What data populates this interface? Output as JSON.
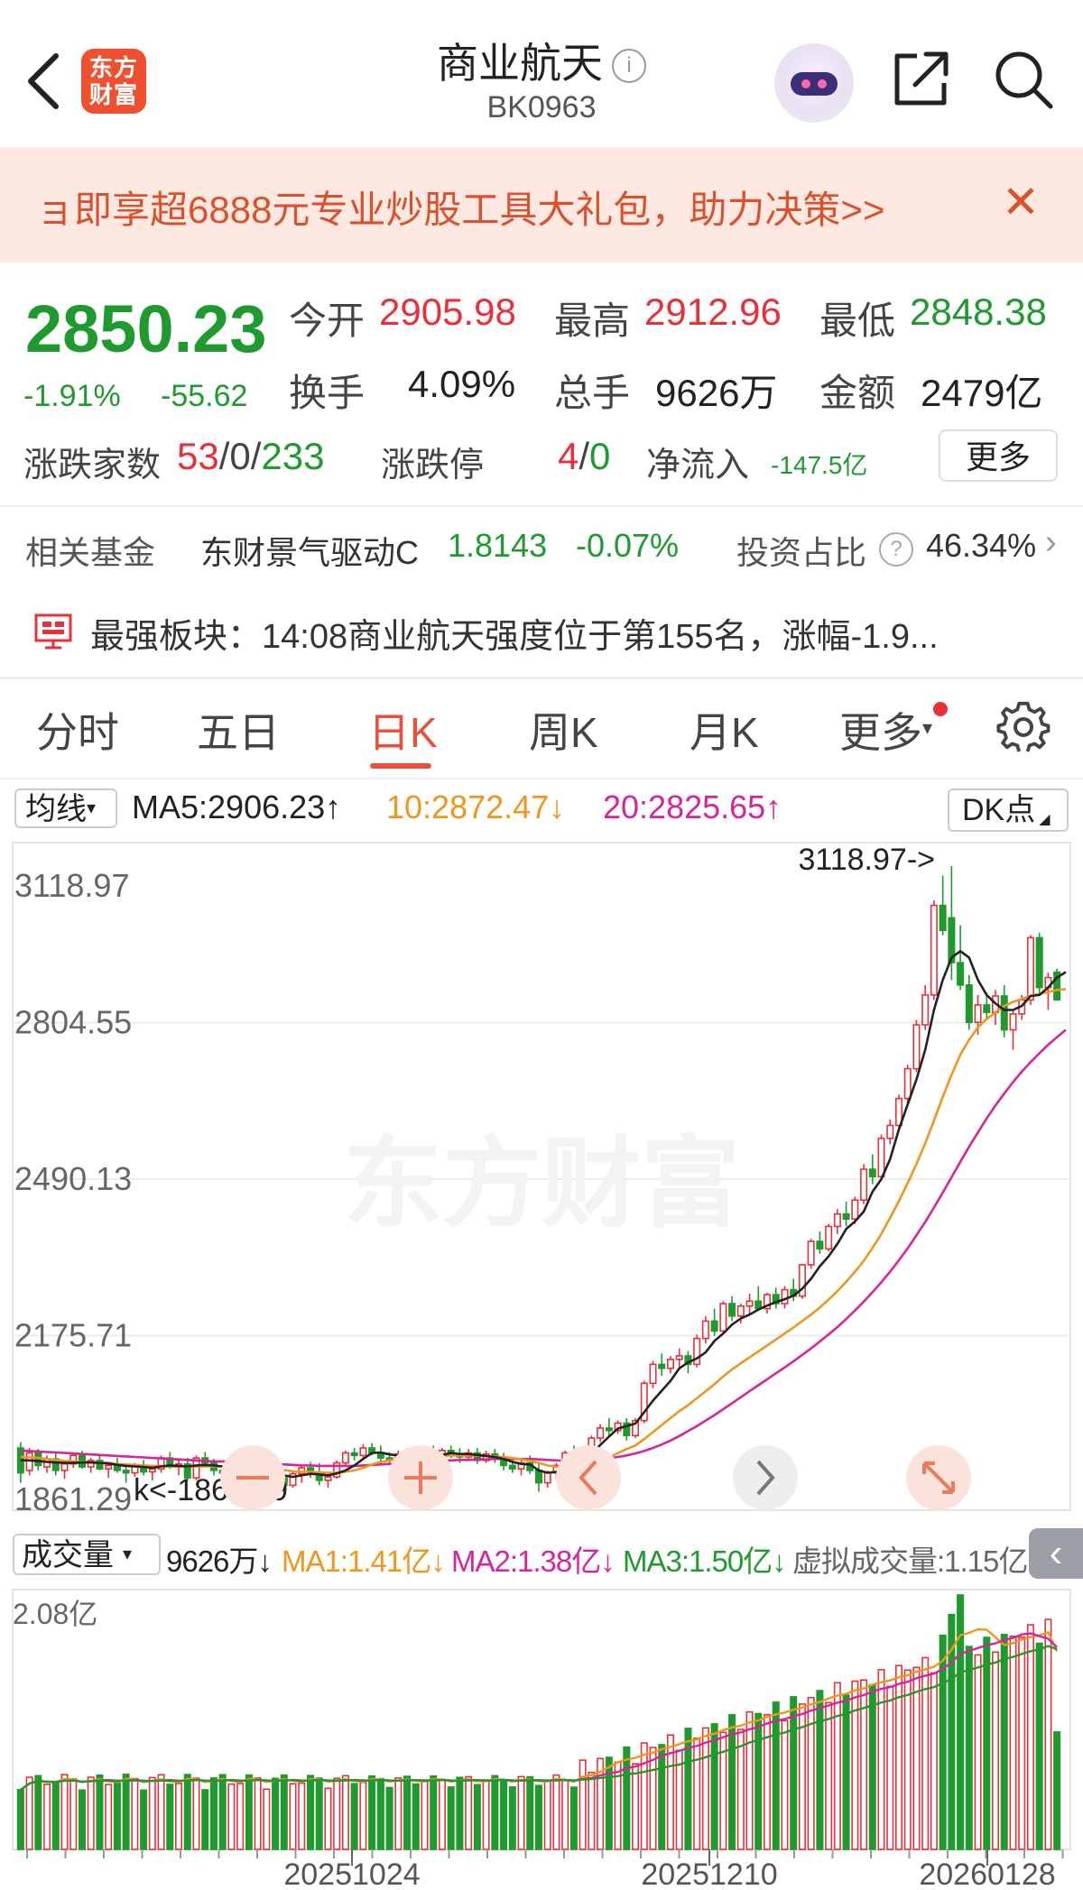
{
  "header": {
    "back_icon": "chevron-left-icon",
    "logo_line1": "东方",
    "logo_line2": "财富",
    "title": "商业航天",
    "info_icon": "i",
    "code": "BK0963",
    "share_icon": "share-icon",
    "search_icon": "search-icon"
  },
  "banner": {
    "text": "ョ即享超6888元专业炒股工具大礼包，助力决策>>",
    "close": "✕"
  },
  "quote": {
    "price": "2850.23",
    "change_pct": "-1.91%",
    "change": "-55.62",
    "open_label": "今开",
    "open": "2905.98",
    "high_label": "最高",
    "high": "2912.96",
    "low_label": "最低",
    "low": "2848.38",
    "turnover_label": "换手",
    "turnover": "4.09%",
    "volume_label": "总手",
    "volume": "9626万",
    "amount_label": "金额",
    "amount": "2479亿",
    "updown_label": "涨跌家数",
    "up": "53",
    "sep1": "/",
    "flat": "0",
    "sep2": "/",
    "down": "233",
    "limit_label": "涨跌停",
    "limit_up": "4",
    "sep3": "/",
    "limit_down": "0",
    "netflow_label": "净流入",
    "netflow": "-147.5亿",
    "more_button": "更多"
  },
  "fund": {
    "label": "相关基金",
    "name": "东财景气驱动C",
    "value": "1.8143",
    "pct": "-0.07%",
    "ratio_label": "投资占比",
    "ratio": "46.34%",
    "arrow": "›"
  },
  "strongest": {
    "text": "最强板块：14:08商业航天强度位于第155名，涨幅-1.9..."
  },
  "tabs": [
    "分时",
    "五日",
    "日K",
    "周K",
    "月K",
    "更多",
    "⚙"
  ],
  "indicators": {
    "ma_select": "均线",
    "ma5": "MA5:2906.23↑",
    "ma10": "10:2872.47↓",
    "ma20": "20:2825.65↑",
    "dk_button": "DK点",
    "colors": {
      "ma5": "#222222",
      "ma10": "#f0961e",
      "ma20": "#d6259c",
      "up": "#e9303a",
      "down": "#1f9a2e"
    }
  },
  "volume_row": {
    "select": "成交量",
    "current": "9626万↓",
    "ma1": "MA1:1.41亿↓",
    "ma2": "MA2:1.38亿↓",
    "ma3": "MA3:1.50亿↓",
    "virtual": "虚拟成交量:1.15亿",
    "collapse_icon": "‹"
  },
  "chart_data": [
    {
      "type": "candlestick",
      "title": "",
      "y_ticks": [
        "3118.97",
        "2804.55",
        "2490.13",
        "2175.71",
        "1861.29"
      ],
      "ylim": [
        1861.29,
        3118.97
      ],
      "max_annotation": "3118.97->",
      "min_annotation": "1861.29",
      "watermark": "东方财富",
      "candles": [
        [
          1950,
          1962,
          1880,
          1900
        ],
        [
          1905,
          1950,
          1895,
          1940
        ],
        [
          1940,
          1948,
          1905,
          1915
        ],
        [
          1912,
          1935,
          1900,
          1928
        ],
        [
          1928,
          1940,
          1895,
          1905
        ],
        [
          1905,
          1925,
          1888,
          1918
        ],
        [
          1918,
          1940,
          1910,
          1935
        ],
        [
          1935,
          1945,
          1908,
          1912
        ],
        [
          1912,
          1930,
          1900,
          1925
        ],
        [
          1925,
          1938,
          1905,
          1908
        ],
        [
          1908,
          1922,
          1890,
          1915
        ],
        [
          1915,
          1930,
          1900,
          1905
        ],
        [
          1905,
          1912,
          1880,
          1900
        ],
        [
          1900,
          1920,
          1892,
          1915
        ],
        [
          1915,
          1926,
          1895,
          1902
        ],
        [
          1902,
          1915,
          1885,
          1908
        ],
        [
          1908,
          1935,
          1900,
          1930
        ],
        [
          1930,
          1942,
          1908,
          1912
        ],
        [
          1912,
          1925,
          1895,
          1918
        ],
        [
          1918,
          1930,
          1885,
          1890
        ],
        [
          1890,
          1935,
          1885,
          1930
        ],
        [
          1930,
          1942,
          1915,
          1920
        ],
        [
          1920,
          1928,
          1895,
          1905
        ],
        [
          1905,
          1915,
          1878,
          1900
        ],
        [
          1900,
          1925,
          1895,
          1912
        ],
        [
          1912,
          1926,
          1900,
          1922
        ],
        [
          1922,
          1928,
          1890,
          1896
        ],
        [
          1896,
          1910,
          1880,
          1905
        ],
        [
          1905,
          1925,
          1895,
          1915
        ],
        [
          1915,
          1925,
          1882,
          1890
        ],
        [
          1890,
          1905,
          1850,
          1875
        ],
        [
          1875,
          1902,
          1870,
          1898
        ],
        [
          1898,
          1915,
          1880,
          1910
        ],
        [
          1910,
          1922,
          1890,
          1900
        ],
        [
          1900,
          1920,
          1875,
          1885
        ],
        [
          1885,
          1898,
          1870,
          1892
        ],
        [
          1892,
          1925,
          1888,
          1920
        ],
        [
          1920,
          1945,
          1915,
          1940
        ],
        [
          1940,
          1950,
          1925,
          1935
        ],
        [
          1935,
          1958,
          1930,
          1950
        ],
        [
          1950,
          1960,
          1935,
          1940
        ],
        [
          1940,
          1955,
          1920,
          1930
        ],
        [
          1930,
          1942,
          1915,
          1925
        ],
        [
          1925,
          1945,
          1918,
          1938
        ],
        [
          1938,
          1950,
          1920,
          1928
        ],
        [
          1928,
          1945,
          1910,
          1920
        ],
        [
          1920,
          1945,
          1918,
          1940
        ],
        [
          1940,
          1955,
          1930,
          1935
        ],
        [
          1935,
          1950,
          1925,
          1945
        ],
        [
          1945,
          1955,
          1930,
          1938
        ],
        [
          1938,
          1950,
          1920,
          1932
        ],
        [
          1932,
          1948,
          1925,
          1940
        ],
        [
          1940,
          1950,
          1918,
          1925
        ],
        [
          1925,
          1945,
          1920,
          1938
        ],
        [
          1938,
          1948,
          1920,
          1930
        ],
        [
          1930,
          1940,
          1905,
          1915
        ],
        [
          1915,
          1930,
          1900,
          1908
        ],
        [
          1908,
          1925,
          1895,
          1920
        ],
        [
          1920,
          1935,
          1898,
          1905
        ],
        [
          1905,
          1920,
          1862,
          1880
        ],
        [
          1880,
          1905,
          1870,
          1900
        ],
        [
          1900,
          1920,
          1888,
          1915
        ],
        [
          1915,
          1945,
          1910,
          1940
        ],
        [
          1940,
          1955,
          1920,
          1928
        ],
        [
          1928,
          1948,
          1920,
          1942
        ],
        [
          1942,
          1975,
          1938,
          1970
        ],
        [
          1970,
          1998,
          1962,
          1990
        ],
        [
          1990,
          2010,
          1975,
          1985
        ],
        [
          1985,
          2005,
          1978,
          2000
        ],
        [
          2000,
          2010,
          1965,
          1975
        ],
        [
          1975,
          2010,
          1970,
          2005
        ],
        [
          2005,
          2085,
          2000,
          2080
        ],
        [
          2080,
          2125,
          2070,
          2118
        ],
        [
          2118,
          2140,
          2095,
          2110
        ],
        [
          2110,
          2135,
          2100,
          2128
        ],
        [
          2128,
          2150,
          2110,
          2135
        ],
        [
          2135,
          2145,
          2100,
          2118
        ],
        [
          2118,
          2178,
          2112,
          2170
        ],
        [
          2170,
          2215,
          2160,
          2205
        ],
        [
          2205,
          2230,
          2175,
          2185
        ],
        [
          2185,
          2245,
          2180,
          2240
        ],
        [
          2240,
          2255,
          2205,
          2215
        ],
        [
          2215,
          2240,
          2200,
          2235
        ],
        [
          2235,
          2260,
          2218,
          2245
        ],
        [
          2245,
          2275,
          2225,
          2230
        ],
        [
          2230,
          2262,
          2220,
          2258
        ],
        [
          2258,
          2272,
          2230,
          2240
        ],
        [
          2240,
          2275,
          2230,
          2268
        ],
        [
          2268,
          2290,
          2245,
          2255
        ],
        [
          2255,
          2320,
          2250,
          2318
        ],
        [
          2318,
          2370,
          2310,
          2365
        ],
        [
          2365,
          2385,
          2340,
          2350
        ],
        [
          2350,
          2400,
          2345,
          2395
        ],
        [
          2395,
          2430,
          2380,
          2420
        ],
        [
          2420,
          2445,
          2395,
          2410
        ],
        [
          2410,
          2455,
          2400,
          2448
        ],
        [
          2448,
          2520,
          2440,
          2510
        ],
        [
          2510,
          2540,
          2480,
          2495
        ],
        [
          2495,
          2580,
          2490,
          2572
        ],
        [
          2572,
          2610,
          2560,
          2598
        ],
        [
          2598,
          2660,
          2590,
          2652
        ],
        [
          2652,
          2720,
          2640,
          2712
        ],
        [
          2712,
          2810,
          2705,
          2800
        ],
        [
          2800,
          2880,
          2790,
          2860
        ],
        [
          2860,
          3050,
          2850,
          3040
        ],
        [
          3040,
          3100,
          2980,
          2990
        ],
        [
          3015,
          3118.97,
          2890,
          2925
        ],
        [
          2925,
          3000,
          2870,
          2880
        ],
        [
          2880,
          2900,
          2790,
          2805
        ],
        [
          2805,
          2860,
          2780,
          2840
        ],
        [
          2840,
          2865,
          2810,
          2825
        ],
        [
          2825,
          2870,
          2800,
          2858
        ],
        [
          2858,
          2880,
          2775,
          2790
        ],
        [
          2790,
          2830,
          2750,
          2822
        ],
        [
          2822,
          2860,
          2810,
          2850
        ],
        [
          2850,
          2980,
          2840,
          2975
        ],
        [
          2975,
          2985,
          2860,
          2875
        ],
        [
          2875,
          2905,
          2830,
          2895
        ],
        [
          2905.98,
          2912.96,
          2848.38,
          2850.23
        ]
      ],
      "ma5": [
        1925,
        1925,
        1924,
        1922,
        1921,
        1920,
        1920,
        1921,
        1921,
        1920,
        1919,
        1916,
        1914,
        1913,
        1912,
        1910,
        1913,
        1915,
        1914,
        1913,
        1915,
        1916,
        1915,
        1913,
        1912,
        1913,
        1912,
        1910,
        1908,
        1906,
        1895,
        1892,
        1895,
        1898,
        1897,
        1895,
        1899,
        1905,
        1915,
        1928,
        1940,
        1941,
        1937,
        1935,
        1932,
        1929,
        1931,
        1934,
        1936,
        1940,
        1938,
        1938,
        1936,
        1934,
        1932,
        1928,
        1922,
        1918,
        1917,
        1905,
        1900,
        1902,
        1908,
        1915,
        1923,
        1938,
        1956,
        1973,
        1989,
        1994,
        1999,
        2022,
        2045,
        2065,
        2085,
        2110,
        2122,
        2130,
        2142,
        2165,
        2180,
        2198,
        2210,
        2218,
        2228,
        2236,
        2243,
        2249,
        2256,
        2270,
        2290,
        2315,
        2335,
        2360,
        2390,
        2405,
        2425,
        2465,
        2490,
        2530,
        2590,
        2640,
        2690,
        2750,
        2830,
        2890,
        2935,
        2948,
        2935,
        2890,
        2860,
        2843,
        2830,
        2830,
        2838,
        2858,
        2860,
        2875,
        2895,
        2906
      ],
      "ma10": [
        1932,
        1931,
        1930,
        1928,
        1926,
        1924,
        1923,
        1922,
        1922,
        1921,
        1920,
        1918,
        1917,
        1916,
        1915,
        1914,
        1914,
        1913,
        1913,
        1913,
        1913,
        1913,
        1913,
        1913,
        1913,
        1912,
        1912,
        1911,
        1910,
        1909,
        1906,
        1903,
        1902,
        1902,
        1901,
        1900,
        1900,
        1902,
        1905,
        1910,
        1917,
        1922,
        1925,
        1929,
        1932,
        1933,
        1934,
        1934,
        1934,
        1935,
        1935,
        1935,
        1935,
        1934,
        1933,
        1932,
        1930,
        1927,
        1924,
        1920,
        1915,
        1912,
        1912,
        1912,
        1912,
        1915,
        1922,
        1930,
        1940,
        1948,
        1955,
        1968,
        1982,
        1996,
        2010,
        2024,
        2036,
        2050,
        2064,
        2078,
        2094,
        2108,
        2120,
        2132,
        2144,
        2156,
        2168,
        2180,
        2192,
        2205,
        2218,
        2232,
        2248,
        2265,
        2284,
        2304,
        2326,
        2352,
        2380,
        2412,
        2446,
        2482,
        2520,
        2562,
        2608,
        2655,
        2700,
        2740,
        2770,
        2795,
        2812,
        2825,
        2838,
        2846,
        2852,
        2858,
        2862,
        2866,
        2870,
        2872
      ],
      "ma20": [
        1945,
        1944,
        1943,
        1942,
        1941,
        1940,
        1939,
        1938,
        1937,
        1936,
        1935,
        1934,
        1933,
        1932,
        1931,
        1930,
        1929,
        1928,
        1927,
        1926,
        1925,
        1924,
        1923,
        1923,
        1922,
        1921,
        1920,
        1920,
        1919,
        1918,
        1917,
        1916,
        1915,
        1915,
        1914,
        1914,
        1914,
        1914,
        1914,
        1915,
        1916,
        1917,
        1918,
        1919,
        1920,
        1921,
        1922,
        1923,
        1924,
        1925,
        1926,
        1926,
        1927,
        1927,
        1928,
        1928,
        1928,
        1928,
        1928,
        1927,
        1926,
        1925,
        1924,
        1924,
        1924,
        1925,
        1927,
        1929,
        1932,
        1935,
        1939,
        1944,
        1950,
        1957,
        1965,
        1974,
        1984,
        1994,
        2005,
        2016,
        2028,
        2040,
        2052,
        2064,
        2076,
        2088,
        2100,
        2112,
        2124,
        2137,
        2150,
        2164,
        2178,
        2193,
        2209,
        2226,
        2244,
        2263,
        2283,
        2304,
        2327,
        2351,
        2377,
        2404,
        2433,
        2463,
        2494,
        2525,
        2555,
        2584,
        2612,
        2638,
        2662,
        2685,
        2706,
        2725,
        2743,
        2760,
        2775,
        2790
      ]
    },
    {
      "type": "bar",
      "title": "",
      "y_ticks": [
        "2.08亿"
      ],
      "ylim": [
        0,
        2.08
      ],
      "x_ticks": [
        "20251024",
        "20251210",
        "20260128"
      ],
      "series_names": [
        "成交量",
        "MA1",
        "MA2",
        "MA3"
      ]
    }
  ]
}
